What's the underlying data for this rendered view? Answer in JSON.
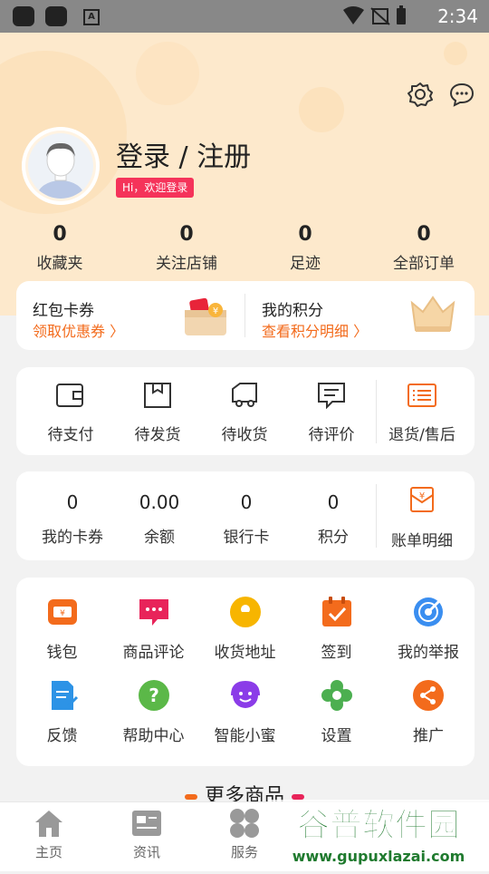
{
  "statusbar": {
    "time": "2:34"
  },
  "profile": {
    "login_title": "登录 / 注册",
    "welcome": "Hi，欢迎登录"
  },
  "stats": [
    {
      "num": "0",
      "label": "收藏夹"
    },
    {
      "num": "0",
      "label": "关注店铺"
    },
    {
      "num": "0",
      "label": "足迹"
    },
    {
      "num": "0",
      "label": "全部订单"
    }
  ],
  "promo": {
    "coupon_title": "红包卡券",
    "coupon_sub": "领取优惠券 〉",
    "points_title": "我的积分",
    "points_sub": "查看积分明细 〉"
  },
  "orders": [
    {
      "label": "待支付",
      "icon": "wallet-icon"
    },
    {
      "label": "待发货",
      "icon": "box-icon"
    },
    {
      "label": "待收货",
      "icon": "truck-icon"
    },
    {
      "label": "待评价",
      "icon": "comment-icon"
    },
    {
      "label": "退货/售后",
      "icon": "return-icon"
    }
  ],
  "account": [
    {
      "num": "0",
      "label": "我的卡券"
    },
    {
      "num": "0.00",
      "label": "余额"
    },
    {
      "num": "0",
      "label": "银行卡"
    },
    {
      "num": "0",
      "label": "积分"
    },
    {
      "label": "账单明细",
      "icon": "bill-icon"
    }
  ],
  "tools": [
    {
      "label": "钱包",
      "icon": "wallet-icon",
      "color": "#f36b1c"
    },
    {
      "label": "商品评论",
      "icon": "comment-icon",
      "color": "#e8245a"
    },
    {
      "label": "收货地址",
      "icon": "location-icon",
      "color": "#f7b500"
    },
    {
      "label": "签到",
      "icon": "calendar-icon",
      "color": "#f36b1c"
    },
    {
      "label": "我的举报",
      "icon": "target-icon",
      "color": "#3a8ef0"
    },
    {
      "label": "反馈",
      "icon": "feedback-icon",
      "color": "#2d93e6"
    },
    {
      "label": "帮助中心",
      "icon": "help-icon",
      "color": "#5bb848"
    },
    {
      "label": "智能小蜜",
      "icon": "assistant-icon",
      "color": "#8b3ce8"
    },
    {
      "label": "设置",
      "icon": "settings-icon",
      "color": "#4caf50"
    },
    {
      "label": "推广",
      "icon": "share-icon",
      "color": "#f36b1c"
    }
  ],
  "more_title": "更多商品",
  "tabs": [
    {
      "label": "主页",
      "icon": "home-icon"
    },
    {
      "label": "资讯",
      "icon": "news-icon"
    },
    {
      "label": "服务",
      "icon": "service-icon"
    }
  ],
  "watermark": {
    "title": "谷普软件园",
    "url": "www.gupuxlazai.com"
  }
}
